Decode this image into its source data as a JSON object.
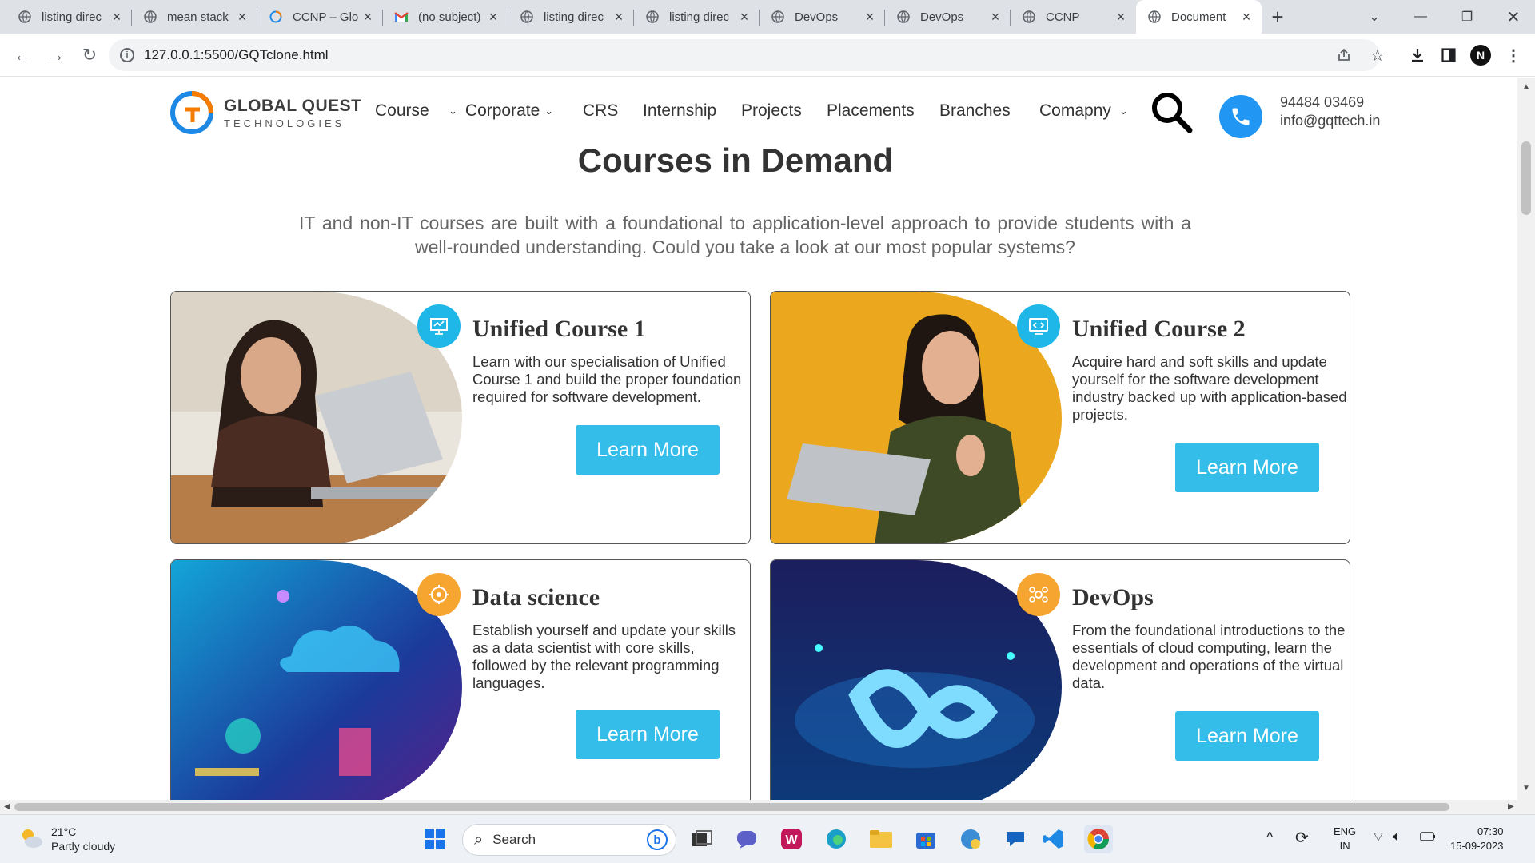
{
  "browser": {
    "tabs": [
      {
        "title": "listing direc",
        "favicon": "globe-icon",
        "active": false
      },
      {
        "title": "mean stack",
        "favicon": "globe-icon",
        "active": false
      },
      {
        "title": "CCNP – Glo",
        "favicon": "gqt-icon",
        "active": false
      },
      {
        "title": "(no subject)",
        "favicon": "gmail-icon",
        "active": false
      },
      {
        "title": "listing direc",
        "favicon": "globe-icon",
        "active": false
      },
      {
        "title": "listing direc",
        "favicon": "globe-icon",
        "active": false
      },
      {
        "title": "DevOps",
        "favicon": "globe-icon",
        "active": false
      },
      {
        "title": "DevOps",
        "favicon": "globe-icon",
        "active": false
      },
      {
        "title": "CCNP",
        "favicon": "globe-icon",
        "active": false
      },
      {
        "title": "Document",
        "favicon": "globe-icon",
        "active": true
      }
    ],
    "url": "127.0.0.1:5500/GQTclone.html",
    "profile_initial": "N"
  },
  "site": {
    "logo": {
      "line1": "GLOBAL QUEST",
      "line2": "TECHNOLOGIES"
    },
    "nav": [
      {
        "label": "Course",
        "dropdown": false
      },
      {
        "label": "Corporate",
        "dropdown": true
      },
      {
        "label": "CRS",
        "dropdown": false
      },
      {
        "label": "Internship",
        "dropdown": false
      },
      {
        "label": "Projects",
        "dropdown": false
      },
      {
        "label": "Placements",
        "dropdown": false
      },
      {
        "label": "Branches",
        "dropdown": false
      },
      {
        "label": "Comapny",
        "dropdown": true
      }
    ],
    "contact": {
      "phone": "94484 03469",
      "email": "info@gqttech.in"
    },
    "heading": "Courses in Demand",
    "lead": "IT and non-IT courses are built with a foundational to application-level approach to provide students with a well-rounded understanding. Could you take a look at our most popular systems?",
    "accent": "#33bde8",
    "cards": [
      {
        "title": "Unified Course 1",
        "text": "Learn with our specialisation of Unified Course 1 and build the proper foundation required for software development.",
        "button": "Learn More",
        "badge_color": "#1fb6e8",
        "badge_icon": "presentation-icon"
      },
      {
        "title": "Unified Course 2",
        "text": "Acquire hard and soft skills and update yourself for the software development industry backed up with application-based projects.",
        "button": "Learn More",
        "badge_color": "#1fb6e8",
        "badge_icon": "code-monitor-icon"
      },
      {
        "title": "Data science",
        "text": "Establish yourself and update your skills as a data scientist with core skills, followed by the relevant programming languages.",
        "button": "Learn More",
        "badge_color": "#f7a531",
        "badge_icon": "data-gear-icon"
      },
      {
        "title": "DevOps",
        "text": "From the foundational introductions to the essentials of cloud computing, learn the development and operations of the virtual data.",
        "button": "Learn More",
        "badge_color": "#f7a531",
        "badge_icon": "network-icon"
      }
    ]
  },
  "taskbar": {
    "weather": {
      "temp": "21°C",
      "desc": "Partly cloudy"
    },
    "search_label": "Search",
    "lang": {
      "line1": "ENG",
      "line2": "IN"
    },
    "time": "07:30",
    "date": "15-09-2023"
  }
}
